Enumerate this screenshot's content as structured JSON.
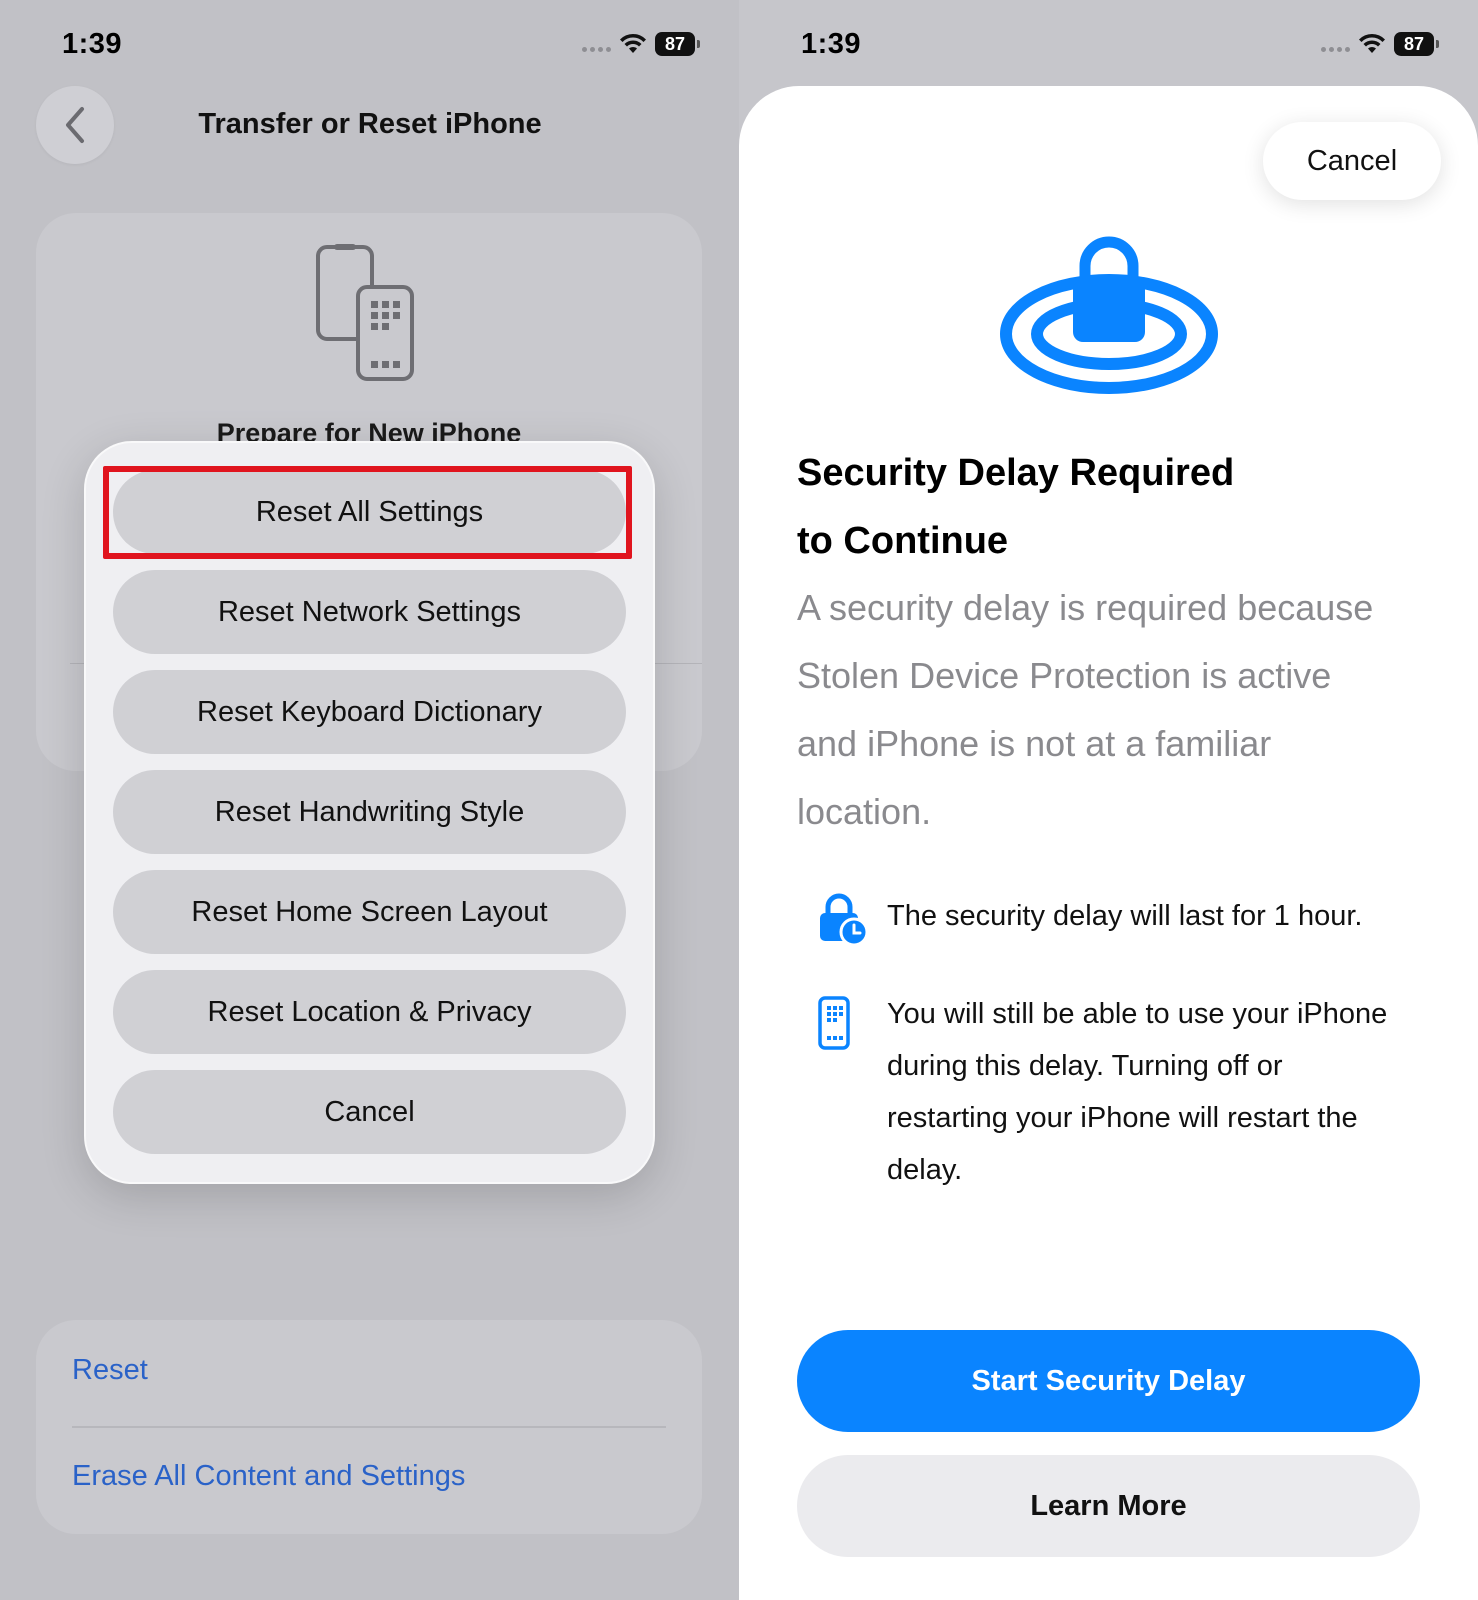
{
  "left": {
    "status": {
      "time": "1:39",
      "battery": "87",
      "wifi_icon": "wifi-icon",
      "signal_icon": "signal-icon"
    },
    "nav": {
      "title": "Transfer or Reset iPhone",
      "back_icon": "chevron-left-icon"
    },
    "prepare_card": {
      "title": "Prepare for New iPhone",
      "icon": "iphone-transfer-icon"
    },
    "reset_card": {
      "reset_label": "Reset",
      "erase_label": "Erase All Content and Settings"
    },
    "action_sheet": {
      "items": [
        "Reset All Settings",
        "Reset Network Settings",
        "Reset Keyboard Dictionary",
        "Reset Handwriting Style",
        "Reset Home Screen Layout",
        "Reset Location & Privacy",
        "Cancel"
      ],
      "highlight_color": "#e0141e"
    }
  },
  "right": {
    "status": {
      "time": "1:39",
      "battery": "87",
      "wifi_icon": "wifi-icon",
      "signal_icon": "signal-icon"
    },
    "sheet": {
      "cancel_label": "Cancel",
      "hero_icon": "security-lock-icon",
      "title_line1": "Security Delay Required",
      "title_line2": "to Continue",
      "body": [
        "A security delay is required because",
        "Stolen Device Protection is active",
        "and iPhone is not at a familiar",
        "location."
      ],
      "info": [
        {
          "icon": "lock-clock-icon",
          "lines": [
            "The security delay will last for 1 hour."
          ]
        },
        {
          "icon": "iphone-icon",
          "lines": [
            "You will still be able to use your iPhone",
            "during this delay. Turning off or",
            "restarting your iPhone will restart the",
            "delay."
          ]
        }
      ],
      "primary_label": "Start Security Delay",
      "secondary_label": "Learn More",
      "accent_color": "#0a84ff"
    }
  }
}
